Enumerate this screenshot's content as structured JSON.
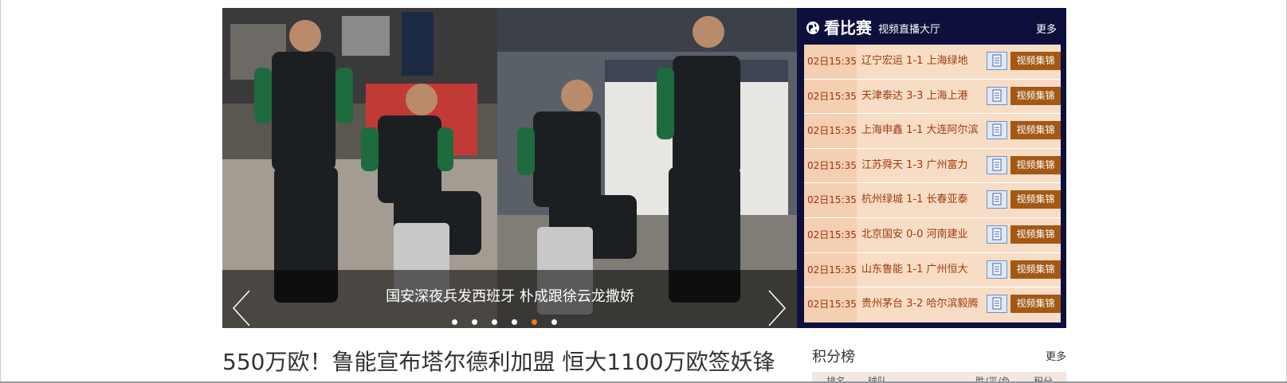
{
  "slider": {
    "caption": "国安深夜兵发西班牙 朴成跟徐云龙撒娇",
    "slide_count": 6,
    "active_index": 4
  },
  "live": {
    "title": "看比赛",
    "subtitle": "视频直播大厅",
    "more": "更多",
    "video_label": "视频集锦",
    "matches": [
      {
        "time": "02日15:35",
        "teams": "辽宁宏运 1-1 上海绿地"
      },
      {
        "time": "02日15:35",
        "teams": "天津泰达 3-3 上海上港"
      },
      {
        "time": "02日15:35",
        "teams": "上海申鑫 1-1 大连阿尔滨"
      },
      {
        "time": "02日15:35",
        "teams": "江苏舜天 1-3 广州富力"
      },
      {
        "time": "02日15:35",
        "teams": "杭州绿城 1-1 长春亚泰"
      },
      {
        "time": "02日15:35",
        "teams": "北京国安 0-0 河南建业"
      },
      {
        "time": "02日15:35",
        "teams": "山东鲁能 1-1 广州恒大"
      },
      {
        "time": "02日15:35",
        "teams": "贵州茅台 3-2 哈尔滨毅腾"
      }
    ]
  },
  "headline": "550万欧！鲁能宣布塔尔德利加盟 恒大1100万欧签妖锋",
  "standings": {
    "title": "积分榜",
    "more": "更多",
    "columns": [
      "排名",
      "球队",
      "胜/平/负",
      "积分"
    ]
  },
  "colors": {
    "live_bg": "#0d0f3d",
    "row_bg": "#f7ddc6",
    "time_bg": "#f5cfb1",
    "video_btn": "#a35814",
    "active_dot": "#f07a1e"
  }
}
